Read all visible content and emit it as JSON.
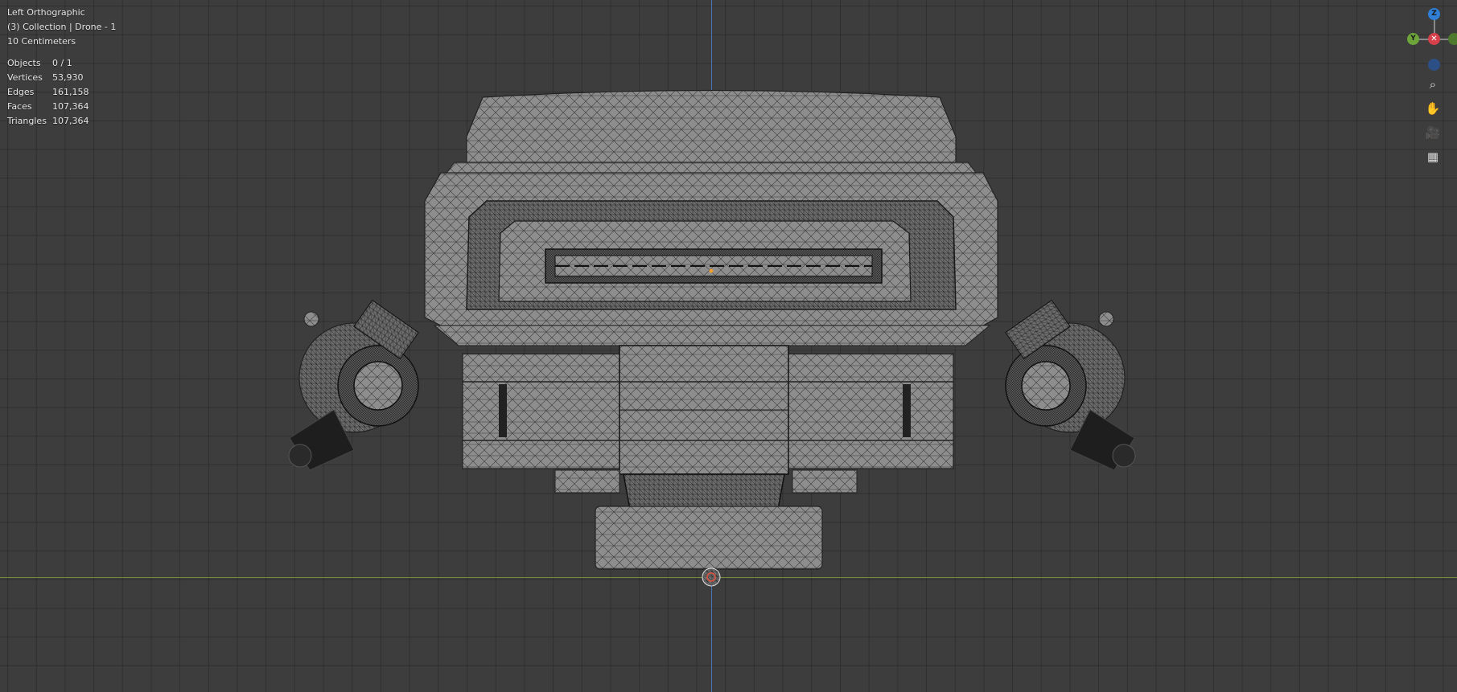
{
  "viewport": {
    "view_name": "Left Orthographic",
    "collection_line": "(3) Collection | Drone - 1",
    "scale_line": "10 Centimeters",
    "stats": [
      {
        "label": "Objects",
        "value": "0 / 1"
      },
      {
        "label": "Vertices",
        "value": "53,930"
      },
      {
        "label": "Edges",
        "value": "161,158"
      },
      {
        "label": "Faces",
        "value": "107,364"
      },
      {
        "label": "Triangles",
        "value": "107,364"
      }
    ]
  },
  "gizmo": {
    "z_label": "Z",
    "y_label": "Y",
    "x_label": "X",
    "colors": {
      "z": "#2f7fd6",
      "y": "#6ea53a",
      "x": "#d6404a",
      "neg": "#3a5a8a"
    }
  },
  "nav_tools": [
    {
      "icon": "zoom-icon",
      "glyph": "⌕"
    },
    {
      "icon": "pan-hand-icon",
      "glyph": "✋"
    },
    {
      "icon": "camera-icon",
      "glyph": "🎥"
    },
    {
      "icon": "grid-ortho-icon",
      "glyph": "▦"
    }
  ],
  "colors": {
    "background": "#3d3d3d",
    "axis_z": "#4a73b8",
    "axis_y": "#6e8c3a",
    "mesh_fill": "#8a8a8a",
    "wire": "#2a2a2a"
  }
}
